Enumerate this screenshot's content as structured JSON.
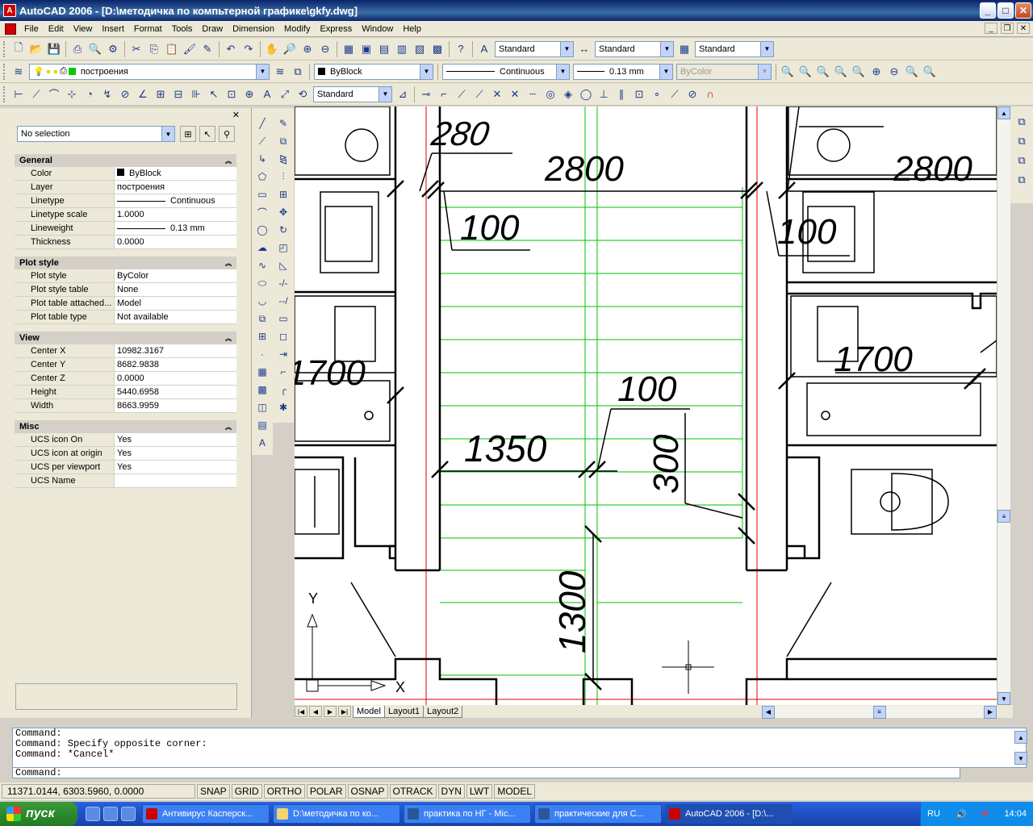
{
  "window": {
    "title": "AutoCAD 2006 - [D:\\методичка по компьтерной графике\\gkfy.dwg]"
  },
  "menu": [
    "File",
    "Edit",
    "View",
    "Insert",
    "Format",
    "Tools",
    "Draw",
    "Dimension",
    "Modify",
    "Express",
    "Window",
    "Help"
  ],
  "toolbar_styles": {
    "text_style": "Standard",
    "dim_style": "Standard",
    "table_style": "Standard"
  },
  "layers_toolbar": {
    "layer": "построения",
    "color": "ByBlock",
    "linetype": "Continuous",
    "lineweight": "0.13 mm",
    "plotstyle": "ByColor"
  },
  "dim_toolbar": {
    "dim_style": "Standard"
  },
  "properties": {
    "selection": "No selection",
    "general": {
      "title": "General",
      "rows": [
        {
          "name": "Color",
          "value": "ByBlock"
        },
        {
          "name": "Layer",
          "value": "построения"
        },
        {
          "name": "Linetype",
          "value": "Continuous"
        },
        {
          "name": "Linetype scale",
          "value": "1.0000"
        },
        {
          "name": "Lineweight",
          "value": "0.13 mm"
        },
        {
          "name": "Thickness",
          "value": "0.0000"
        }
      ]
    },
    "plot_style": {
      "title": "Plot style",
      "rows": [
        {
          "name": "Plot style",
          "value": "ByColor"
        },
        {
          "name": "Plot style table",
          "value": "None"
        },
        {
          "name": "Plot table attached...",
          "value": "Model"
        },
        {
          "name": "Plot table type",
          "value": "Not available"
        }
      ]
    },
    "view": {
      "title": "View",
      "rows": [
        {
          "name": "Center X",
          "value": "10982.3167"
        },
        {
          "name": "Center Y",
          "value": "8682.9838"
        },
        {
          "name": "Center Z",
          "value": "0.0000"
        },
        {
          "name": "Height",
          "value": "5440.6958"
        },
        {
          "name": "Width",
          "value": "8663.9959"
        }
      ]
    },
    "misc": {
      "title": "Misc",
      "rows": [
        {
          "name": "UCS icon On",
          "value": "Yes"
        },
        {
          "name": "UCS icon at origin",
          "value": "Yes"
        },
        {
          "name": "UCS per viewport",
          "value": "Yes"
        },
        {
          "name": "UCS Name",
          "value": ""
        }
      ]
    }
  },
  "drawing": {
    "dims": [
      "280",
      "2800",
      "2800",
      "100",
      "100",
      "1700",
      "1700",
      "100",
      "1350",
      "300",
      "1300"
    ],
    "ucs_x": "X",
    "ucs_y": "Y"
  },
  "layout_tabs": [
    "Model",
    "Layout1",
    "Layout2"
  ],
  "command": {
    "history": [
      "Command:",
      "Command: Specify opposite corner:",
      "Command: *Cancel*"
    ],
    "prompt": "Command:"
  },
  "status": {
    "coords": "11371.0144, 6303.5960, 0.0000",
    "buttons": [
      "SNAP",
      "GRID",
      "ORTHO",
      "POLAR",
      "OSNAP",
      "OTRACK",
      "DYN",
      "LWT",
      "MODEL"
    ]
  },
  "taskbar": {
    "start": "пуск",
    "tasks": [
      "Антивирус Касперск...",
      "D:\\методичка по ко...",
      "практика по НГ - Mic...",
      "практические для С...",
      "AutoCAD 2006 - [D:\\..."
    ],
    "lang": "RU",
    "clock": "14:04"
  },
  "colors": {
    "title_bar": "#0a246a",
    "green_hatch": "#00c000",
    "red_axis": "#e00000",
    "taskbar": "#245edb"
  }
}
